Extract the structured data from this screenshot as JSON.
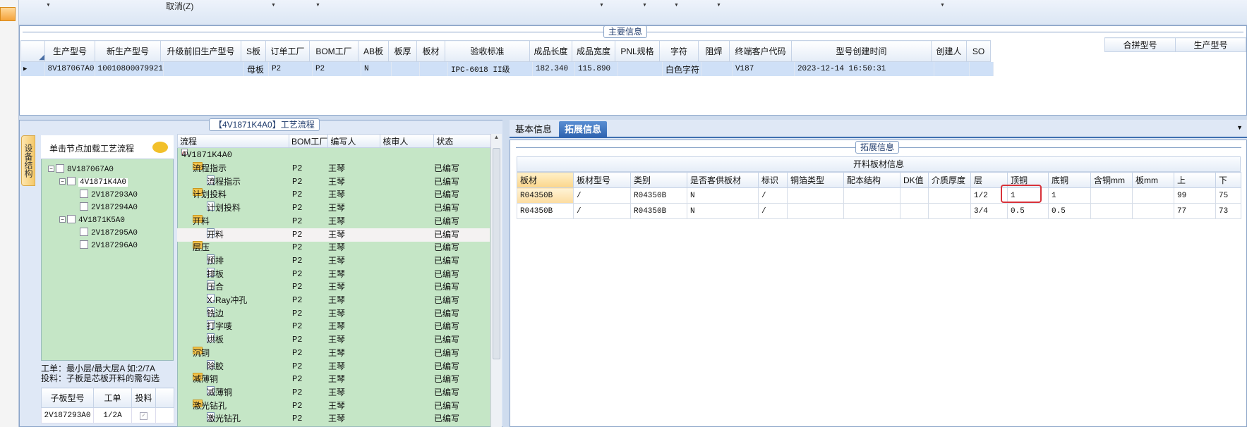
{
  "toolbar": {
    "cancel_label": "取消(Z)"
  },
  "main_info": {
    "title": "主要信息",
    "columns": [
      "生产型号",
      "新生产型号",
      "升级前旧生产型号",
      "S板",
      "订单工厂",
      "BOM工厂",
      "AB板",
      "板厚",
      "板材",
      "验收标准",
      "成品长度",
      "成品宽度",
      "PNL规格",
      "字符",
      "阻焊",
      "终端客户代码",
      "型号创建时间",
      "创建人",
      "SO"
    ],
    "row": [
      "8V187067A0",
      "10010800079921",
      "",
      "母板",
      "P2",
      "P2",
      "N",
      "",
      "",
      "IPC-6018 II级",
      "182.340",
      "115.890",
      "",
      "白色字符",
      "",
      "V187",
      "2023-12-14 16:50:31",
      "",
      ""
    ],
    "merge_columns": [
      "合拼型号",
      "生产型号"
    ]
  },
  "left_panel": {
    "vertical_tab": "设备结构",
    "load_tip": "单击节点加载工艺流程",
    "tree": [
      "8V187067A0",
      "4V1871K4A0",
      "2V187293A0",
      "2V187294A0",
      "4V1871K5A0",
      "2V187295A0",
      "2V187296A0"
    ],
    "work_info_1": "工单：最小层/最大层A 如:2/7A",
    "work_info_2": "投料：子板是芯板开料的需勾选",
    "sub_columns": [
      "子板型号",
      "工单",
      "投料"
    ],
    "sub_rows": [
      [
        "2V187293A0",
        "1/2A",
        ""
      ]
    ]
  },
  "process": {
    "title": "【4V1871K4A0】工艺流程",
    "columns": [
      "流程",
      "BOM工厂",
      "编写人",
      "核审人",
      "状态"
    ],
    "root": "4V1871K4A0",
    "rows": [
      {
        "name": "流程指示",
        "level": 1,
        "folder": true,
        "bom": "P2",
        "writer": "王琴",
        "status": "已编写"
      },
      {
        "name": "流程指示",
        "level": 2,
        "folder": false,
        "bom": "P2",
        "writer": "王琴",
        "status": "已编写"
      },
      {
        "name": "计划投料",
        "level": 1,
        "folder": true,
        "bom": "P2",
        "writer": "王琴",
        "status": "已编写"
      },
      {
        "name": "计划投料",
        "level": 2,
        "folder": false,
        "bom": "P2",
        "writer": "王琴",
        "status": "已编写"
      },
      {
        "name": "开料",
        "level": 1,
        "folder": true,
        "bom": "P2",
        "writer": "王琴",
        "status": "已编写"
      },
      {
        "name": "开料",
        "level": 2,
        "folder": false,
        "bom": "P2",
        "writer": "王琴",
        "status": "已编写"
      },
      {
        "name": "层压",
        "level": 1,
        "folder": true,
        "bom": "P2",
        "writer": "王琴",
        "status": "已编写"
      },
      {
        "name": "预排",
        "level": 2,
        "folder": false,
        "bom": "P2",
        "writer": "王琴",
        "status": "已编写"
      },
      {
        "name": "排板",
        "level": 2,
        "folder": false,
        "bom": "P2",
        "writer": "王琴",
        "status": "已编写"
      },
      {
        "name": "压合",
        "level": 2,
        "folder": false,
        "bom": "P2",
        "writer": "王琴",
        "status": "已编写"
      },
      {
        "name": "X-Ray冲孔",
        "level": 2,
        "folder": false,
        "bom": "P2",
        "writer": "王琴",
        "status": "已编写"
      },
      {
        "name": "铣边",
        "level": 2,
        "folder": false,
        "bom": "P2",
        "writer": "王琴",
        "status": "已编写"
      },
      {
        "name": "打字唛",
        "level": 2,
        "folder": false,
        "bom": "P2",
        "writer": "王琴",
        "status": "已编写"
      },
      {
        "name": "烘板",
        "level": 2,
        "folder": false,
        "bom": "P2",
        "writer": "王琴",
        "status": "已编写"
      },
      {
        "name": "沉铜",
        "level": 1,
        "folder": true,
        "bom": "P2",
        "writer": "王琴",
        "status": "已编写"
      },
      {
        "name": "除胶",
        "level": 2,
        "folder": false,
        "bom": "P2",
        "writer": "王琴",
        "status": "已编写"
      },
      {
        "name": "减薄铜",
        "level": 1,
        "folder": true,
        "bom": "P2",
        "writer": "王琴",
        "status": "已编写"
      },
      {
        "name": "减薄铜",
        "level": 2,
        "folder": false,
        "bom": "P2",
        "writer": "王琴",
        "status": "已编写"
      },
      {
        "name": "激光钻孔",
        "level": 1,
        "folder": true,
        "bom": "P2",
        "writer": "王琴",
        "status": "已编写"
      },
      {
        "name": "激光钻孔",
        "level": 2,
        "folder": false,
        "bom": "P2",
        "writer": "王琴",
        "status": "已编写"
      }
    ]
  },
  "right_panel": {
    "tabs": [
      "基本信息",
      "拓展信息"
    ],
    "group_title": "拓展信息",
    "table_title": "开料板材信息",
    "columns": [
      "板材",
      "板材型号",
      "类别",
      "是否客供板材",
      "标识",
      "铜箔类型",
      "配本结构",
      "DK值",
      "介质厚度",
      "层",
      "顶铜",
      "底铜",
      "含铜mm",
      "板mm",
      "上",
      "下"
    ],
    "rows": [
      [
        "R04350B",
        "/",
        "R04350B",
        "N",
        "/",
        "",
        "",
        "",
        "",
        "1/2",
        "1",
        "1",
        "",
        "",
        "99",
        "75"
      ],
      [
        "R04350B",
        "/",
        "R04350B",
        "N",
        "/",
        "",
        "",
        "",
        "",
        "3/4",
        "0.5",
        "0.5",
        "",
        "",
        "77",
        "73"
      ]
    ]
  }
}
